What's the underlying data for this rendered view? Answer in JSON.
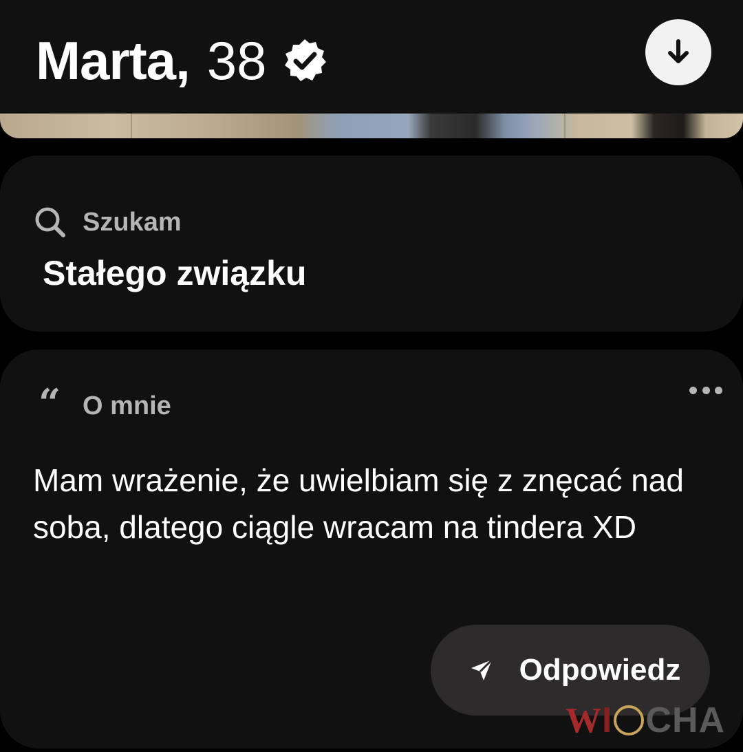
{
  "profile": {
    "name": "Marta",
    "comma": ",",
    "age": "38"
  },
  "sections": {
    "looking_for": {
      "label": "Szukam",
      "value": "Stałego związku"
    },
    "about": {
      "label": "O mnie",
      "text": "Mam wrażenie, że uwielbiam się z znęcać nad soba, dlatego ciągle wracam na tindera XD"
    }
  },
  "actions": {
    "reply_label": "Odpowiedz"
  },
  "watermark": {
    "text_w": "W",
    "text_i": "I",
    "text_rest": "CHA",
    "full": "WIOCHA"
  },
  "icons": {
    "verified": "verified-badge-icon",
    "download": "arrow-down-icon",
    "search": "search-icon",
    "quote": "quote-icon",
    "more": "more-dots-icon",
    "send": "send-icon"
  },
  "colors": {
    "background": "#000000",
    "card": "#121111",
    "label": "#b5b5b5",
    "reply_button": "#2d2b2b"
  }
}
